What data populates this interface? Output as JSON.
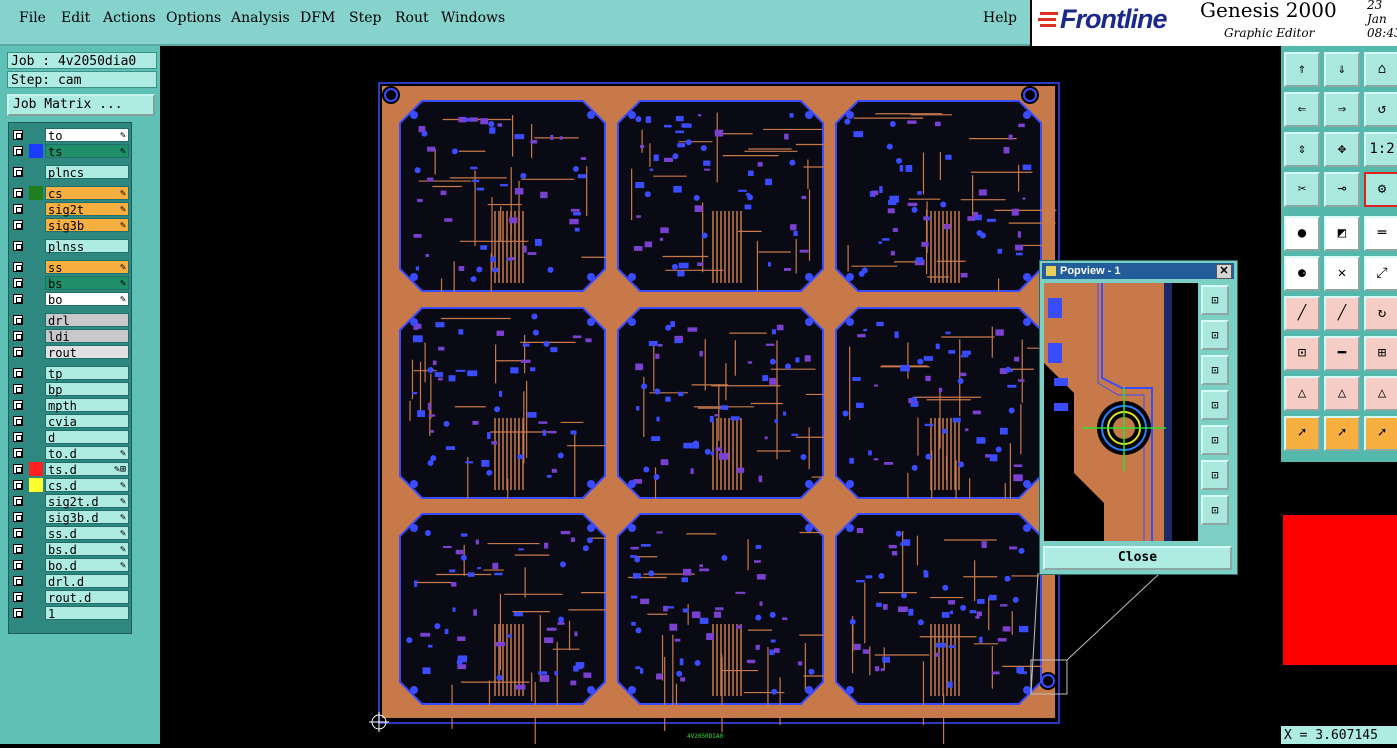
{
  "menu": {
    "items": [
      "File",
      "Edit",
      "Actions",
      "Options",
      "Analysis",
      "DFM",
      "Step",
      "Rout",
      "Windows"
    ],
    "help": "Help"
  },
  "brand": {
    "logo": "Frontline",
    "title": "Genesis 2000",
    "subtitle": "Graphic Editor",
    "date": "23  Jan",
    "time": "08:43"
  },
  "job": {
    "job_label": "Job : 4v2050dia0",
    "step_label": "Step: cam",
    "matrix_button": "Job Matrix ..."
  },
  "layers": [
    {
      "name": "to",
      "bg": "#ffffff",
      "color": "",
      "mark": "✎"
    },
    {
      "name": "ts",
      "bg": "#1f8f6a",
      "color": "#1a3cff",
      "mark": "✎"
    },
    {
      "name": "plncs",
      "bg": "#aeebe3",
      "color": "",
      "mark": ""
    },
    {
      "name": "cs",
      "bg": "#f7b040",
      "color": "#1f7f1f",
      "mark": "✎"
    },
    {
      "name": "sig2t",
      "bg": "#f7b040",
      "color": "",
      "mark": "✎"
    },
    {
      "name": "sig3b",
      "bg": "#f7b040",
      "color": "",
      "mark": "✎"
    },
    {
      "name": "plnss",
      "bg": "#aeebe3",
      "color": "",
      "mark": ""
    },
    {
      "name": "ss",
      "bg": "#f7b040",
      "color": "",
      "mark": "✎"
    },
    {
      "name": "bs",
      "bg": "#1f8f6a",
      "color": "",
      "mark": "✎"
    },
    {
      "name": "bo",
      "bg": "#ffffff",
      "color": "",
      "mark": "✎"
    },
    {
      "name": "drl",
      "bg": "#c8c8c8",
      "color": "",
      "mark": ""
    },
    {
      "name": "ldi",
      "bg": "#c8c8c8",
      "color": "",
      "mark": ""
    },
    {
      "name": "rout",
      "bg": "#e0e0e0",
      "color": "",
      "mark": ""
    },
    {
      "name": "tp",
      "bg": "#aeebe3",
      "color": "",
      "mark": ""
    },
    {
      "name": "bp",
      "bg": "#aeebe3",
      "color": "",
      "mark": ""
    },
    {
      "name": "mpth",
      "bg": "#aeebe3",
      "color": "",
      "mark": ""
    },
    {
      "name": "cvia",
      "bg": "#aeebe3",
      "color": "",
      "mark": ""
    },
    {
      "name": "d",
      "bg": "#aeebe3",
      "color": "",
      "mark": ""
    },
    {
      "name": "to.d",
      "bg": "#aeebe3",
      "color": "",
      "mark": "✎"
    },
    {
      "name": "ts.d",
      "bg": "#aeebe3",
      "color": "#ff2020",
      "mark": "✎⊞"
    },
    {
      "name": "cs.d",
      "bg": "#aeebe3",
      "color": "#ffff30",
      "mark": "✎"
    },
    {
      "name": "sig2t.d",
      "bg": "#aeebe3",
      "color": "",
      "mark": "✎"
    },
    {
      "name": "sig3b.d",
      "bg": "#aeebe3",
      "color": "",
      "mark": "✎"
    },
    {
      "name": "ss.d",
      "bg": "#aeebe3",
      "color": "",
      "mark": "✎"
    },
    {
      "name": "bs.d",
      "bg": "#aeebe3",
      "color": "",
      "mark": "✎"
    },
    {
      "name": "bo.d",
      "bg": "#aeebe3",
      "color": "",
      "mark": "✎"
    },
    {
      "name": "drl.d",
      "bg": "#aeebe3",
      "color": "",
      "mark": ""
    },
    {
      "name": "rout.d",
      "bg": "#aeebe3",
      "color": "",
      "mark": ""
    },
    {
      "name": "1",
      "bg": "#aeebe3",
      "color": "",
      "mark": ""
    }
  ],
  "layer_group_gaps_after": [
    1,
    2,
    5,
    6,
    9,
    12
  ],
  "popview": {
    "title": "Popview - 1",
    "close_button": "Close",
    "close_x": "✕"
  },
  "toolbar": {
    "labels": [
      "⇑",
      "⇓",
      "⌂",
      "⇐",
      "⇒",
      "↺",
      "⇕",
      "✥",
      "1:2",
      "✂",
      "⊸",
      "⚙",
      "●",
      "◩",
      "═",
      "⚈",
      "✕",
      "⤢",
      "╱",
      "╱",
      "↻",
      "⊡",
      "━",
      "⊞",
      "△",
      "△",
      "△",
      "➚",
      "➚",
      "➚"
    ]
  },
  "colors": {
    "panel": "#5fc1b6",
    "copper": "#c8794a",
    "red_view": "#ff0000"
  },
  "status": {
    "coord": "X = 3.607145"
  },
  "board_label": "4V2050DIA0"
}
